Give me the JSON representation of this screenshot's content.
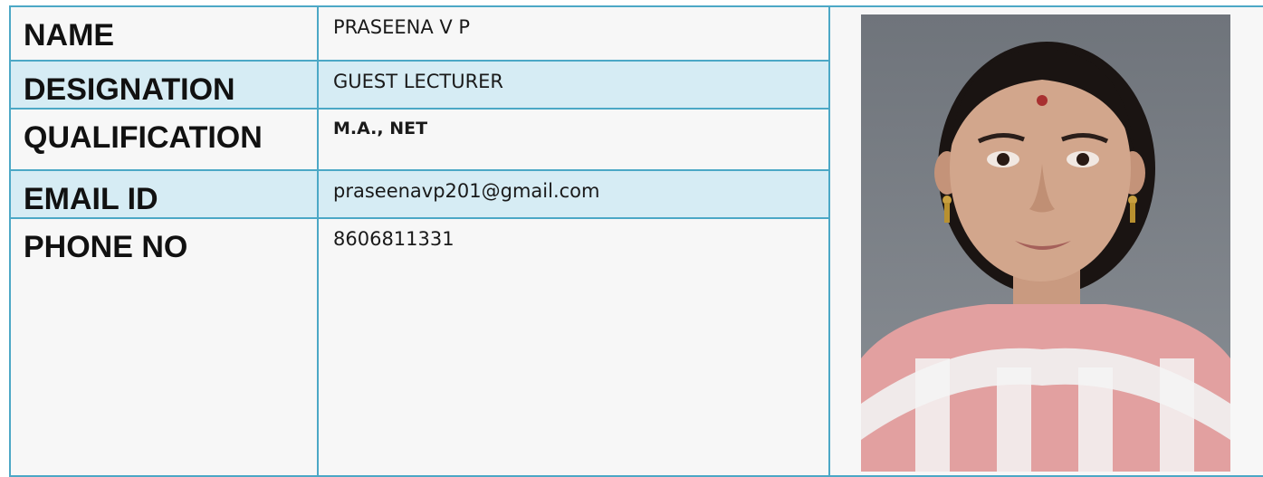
{
  "profile": {
    "rows": [
      {
        "label": "NAME",
        "value": "PRASEENA V P"
      },
      {
        "label": "DESIGNATION",
        "value": "GUEST LECTURER"
      },
      {
        "label": "QUALIFICATION",
        "value": "M.A., NET"
      },
      {
        "label": "EMAIL ID",
        "value": "praseenavp201@gmail.com"
      },
      {
        "label": "PHONE NO",
        "value": "8606811331"
      }
    ],
    "photo_icon": "portrait-photo"
  },
  "colors": {
    "border": "#4ca8c6",
    "alt_row_bg": "#d6ecf4",
    "row_bg": "#f7f7f7"
  }
}
